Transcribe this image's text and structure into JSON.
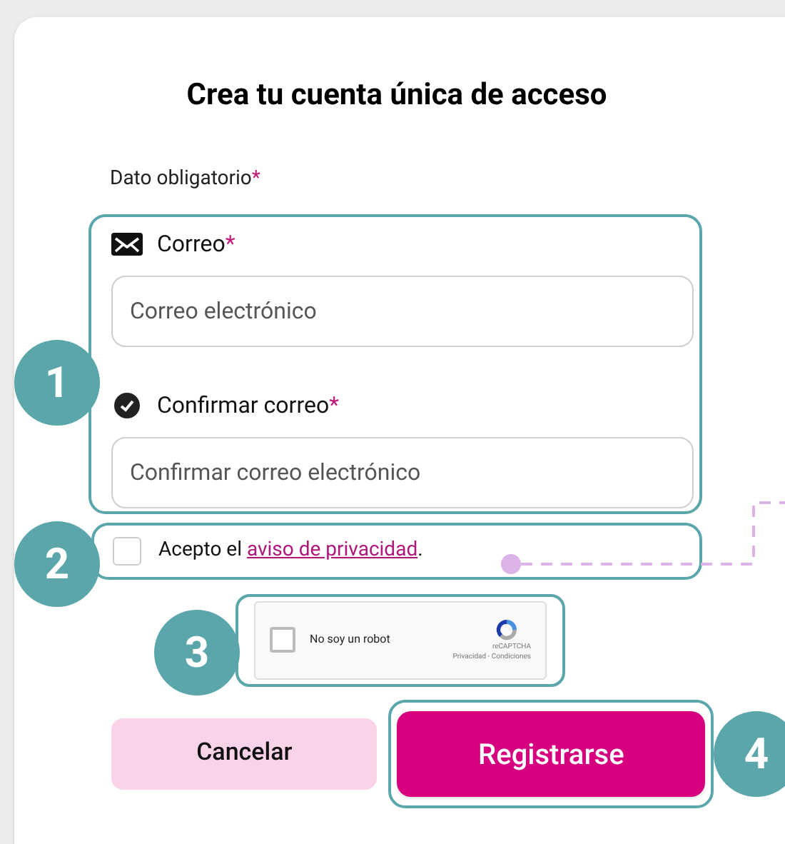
{
  "title": "Crea tu cuenta única de acceso",
  "required_note": {
    "text": "Dato obligatorio",
    "mark": "*"
  },
  "fields": [
    {
      "label": "Correo",
      "mark": "*",
      "kind": "email",
      "placeholder": "Correo electrónico"
    },
    {
      "label": "Confirmar correo",
      "mark": "*",
      "kind": "confirm",
      "placeholder": "Confirmar correo electrónico"
    }
  ],
  "consent": {
    "checked": false,
    "prefix": "Acepto el",
    "link": "aviso de privacidad",
    "suffix": "."
  },
  "captcha": {
    "checked": false,
    "label": "No soy un robot",
    "brand": "reCAPTCHA",
    "links": "Privacidad - Condiciones"
  },
  "buttons": [
    {
      "label": "Cancelar",
      "kind": "secondary"
    },
    {
      "label": "Registrarse",
      "kind": "primary"
    }
  ],
  "callouts": [
    "1",
    "2",
    "3",
    "4"
  ]
}
